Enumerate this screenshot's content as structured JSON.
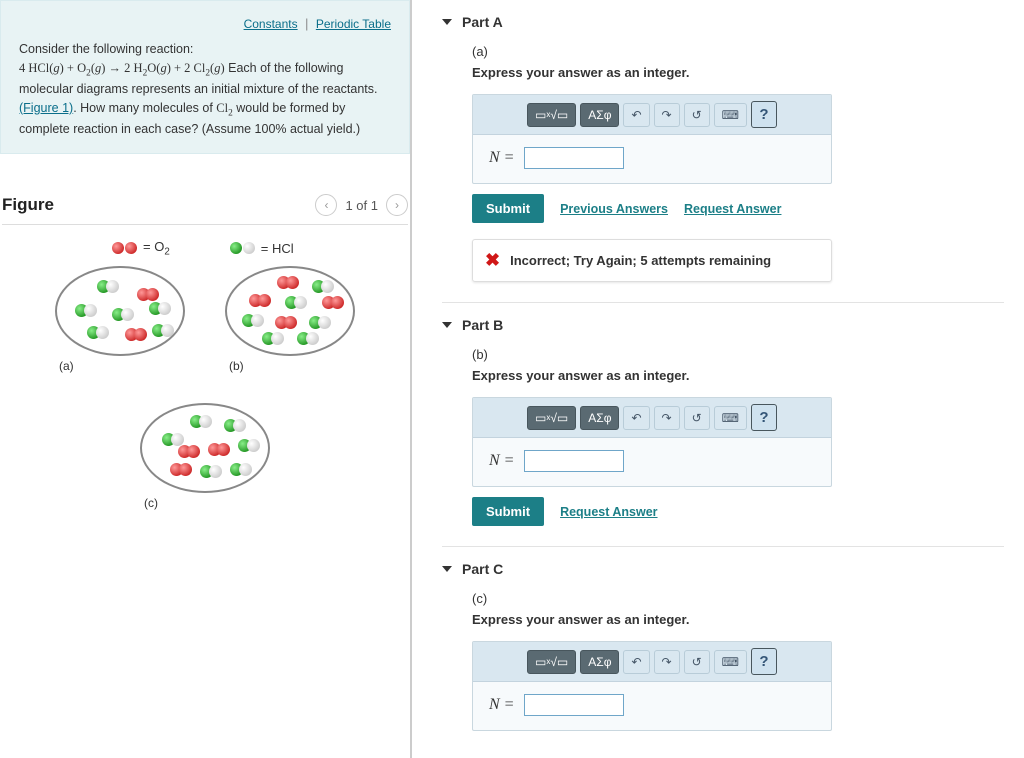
{
  "intro": {
    "links": {
      "constants": "Constants",
      "ptable": "Periodic Table"
    },
    "pre": "Consider the following reaction:",
    "post1": " Each of the following molecular diagrams represents an initial mixture of the reactants. ",
    "figref": "(Figure 1)",
    "post2": ". How many molecules of ",
    "post3": " would be formed by complete reaction in each case? (Assume 100% actual yield.)"
  },
  "figure": {
    "title": "Figure",
    "page": "1 of 1",
    "legend_o2": "= O",
    "legend_o2_sub": "2",
    "legend_hcl": "= HCl",
    "labels": {
      "a": "(a)",
      "b": "(b)",
      "c": "(c)"
    }
  },
  "parts": {
    "a": {
      "title": "Part A",
      "sub": "(a)",
      "instr": "Express your answer as an integer.",
      "var": "N",
      "submit": "Submit",
      "prev": "Previous Answers",
      "req": "Request Answer",
      "feedback": "Incorrect; Try Again; 5 attempts remaining"
    },
    "b": {
      "title": "Part B",
      "sub": "(b)",
      "instr": "Express your answer as an integer.",
      "var": "N",
      "submit": "Submit",
      "req": "Request Answer"
    },
    "c": {
      "title": "Part C",
      "sub": "(c)",
      "instr": "Express your answer as an integer.",
      "var": "N"
    }
  },
  "toolbar": {
    "greek": "ΑΣφ",
    "help": "?"
  }
}
